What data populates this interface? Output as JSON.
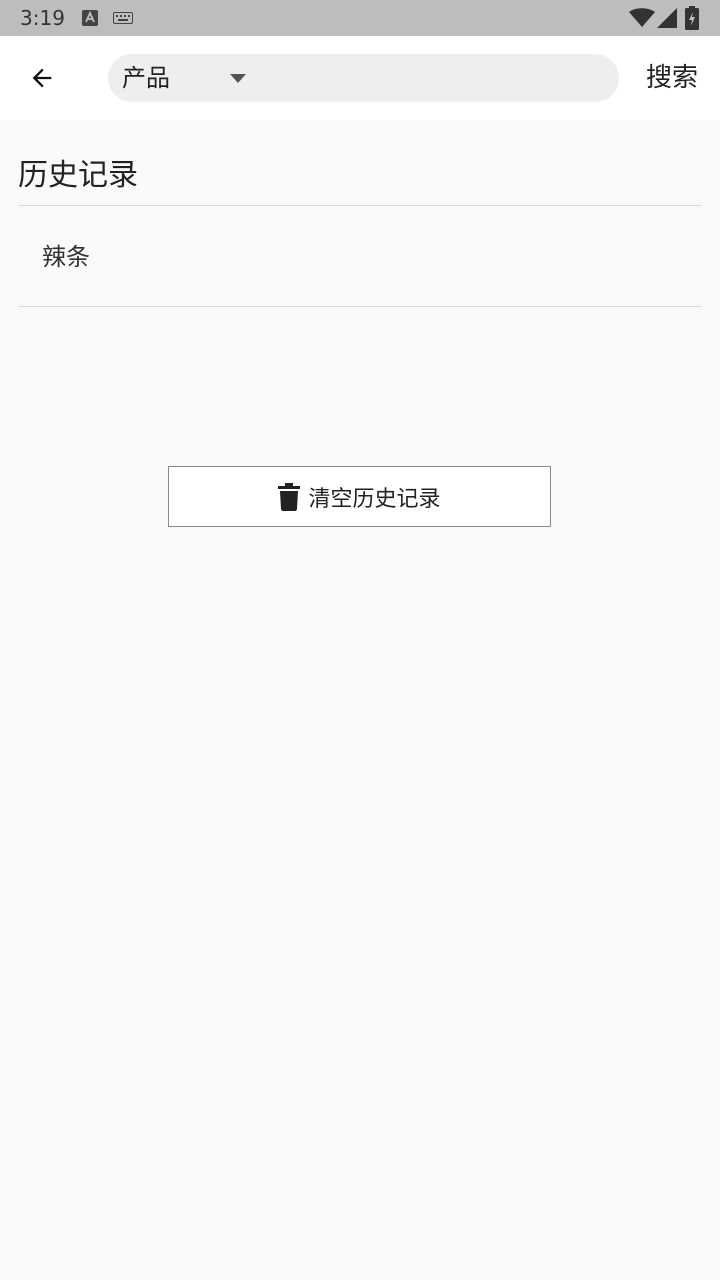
{
  "status_bar": {
    "time": "3:19",
    "icons": [
      "keyboard-a-icon",
      "keyboard-icon",
      "wifi-icon",
      "signal-icon",
      "battery-charging-icon"
    ]
  },
  "app_bar": {
    "back_icon": "arrow-back-icon",
    "category": "产品",
    "search_value": "",
    "search_placeholder": "",
    "search_button_label": "搜索"
  },
  "history": {
    "title": "历史记录",
    "items": [
      {
        "label": "辣条"
      }
    ]
  },
  "clear_button": {
    "icon": "trash-icon",
    "label": "清空历史记录"
  },
  "colors": {
    "status_bar_bg": "#bdbdbd",
    "app_bar_bg": "#ffffff",
    "page_bg": "#fafafa",
    "search_box_bg": "#eeeeee",
    "divider": "#d9d9d9",
    "button_border": "#8a8a8a"
  }
}
